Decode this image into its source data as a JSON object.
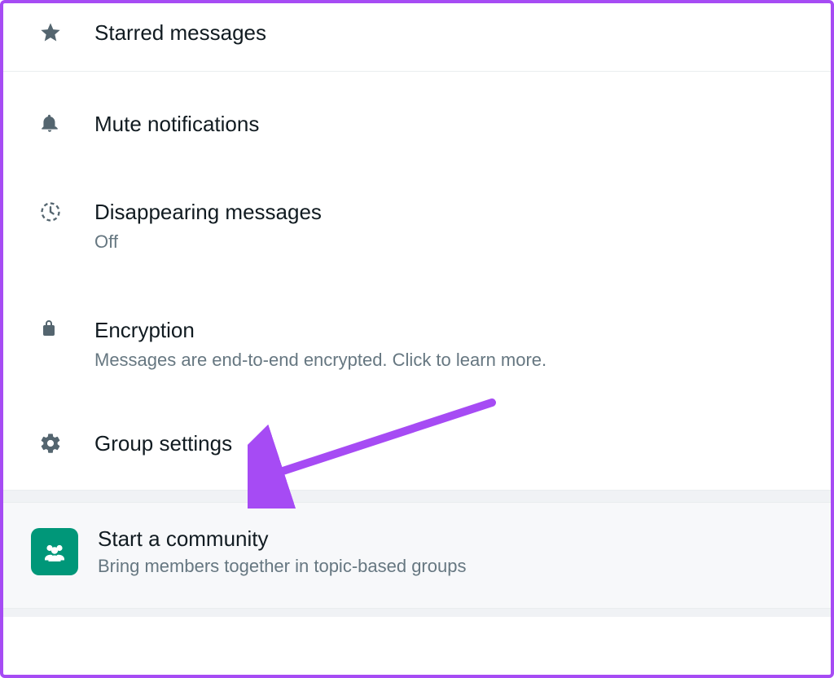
{
  "settings": {
    "starred": {
      "label": "Starred messages"
    },
    "mute": {
      "label": "Mute notifications"
    },
    "disappearing": {
      "label": "Disappearing messages",
      "value": "Off"
    },
    "encryption": {
      "label": "Encryption",
      "description": "Messages are end-to-end encrypted. Click to learn more."
    },
    "group_settings": {
      "label": "Group settings"
    }
  },
  "community": {
    "title": "Start a community",
    "subtitle": "Bring members together in topic-based groups"
  },
  "annotation": {
    "color": "#a64bf4"
  }
}
